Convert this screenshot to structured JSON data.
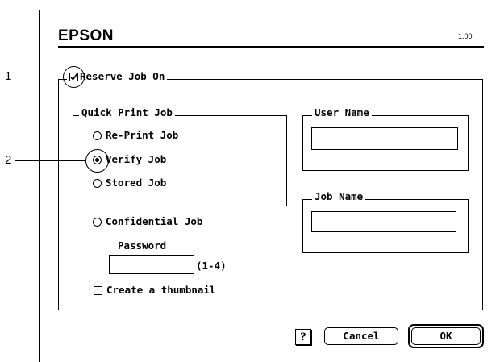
{
  "header": {
    "brand": "EPSON",
    "version": "1.00"
  },
  "reserve": {
    "label": "Reserve Job On",
    "checked": true
  },
  "quick_print": {
    "legend": "Quick Print Job",
    "options": [
      {
        "label": "Re-Print Job",
        "selected": false
      },
      {
        "label": "Verify Job",
        "selected": true
      },
      {
        "label": "Stored Job",
        "selected": false
      }
    ]
  },
  "confidential": {
    "label": "Confidential Job",
    "selected": false,
    "password_label": "Password",
    "password_value": "",
    "password_hint": "(1-4)"
  },
  "thumbnail": {
    "label": "Create a thumbnail",
    "checked": false
  },
  "user_name": {
    "legend": "User Name",
    "value": ""
  },
  "job_name": {
    "legend": "Job Name",
    "value": ""
  },
  "buttons": {
    "help": "?",
    "cancel": "Cancel",
    "ok": "OK"
  },
  "callouts": [
    "1",
    "2"
  ]
}
